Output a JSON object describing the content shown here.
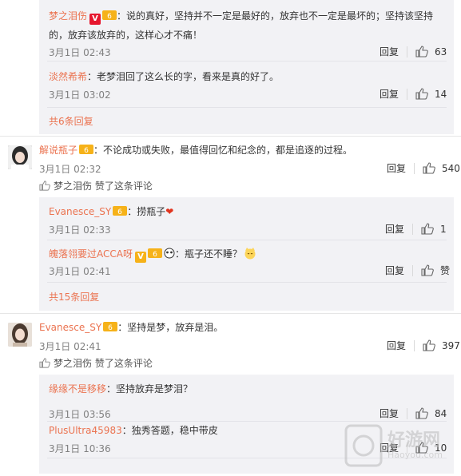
{
  "thread1": {
    "replies": [
      {
        "user": "梦之泪伤",
        "text_line1": "：说的真好，坚持并不一定是最好的，放弃也不一定是最坏的；坚持该坚持",
        "text_line2": "的，放弃该放弃的，这样心才不痛！",
        "time": "3月1日 02:43",
        "reply_label": "回复",
        "likes": "63"
      },
      {
        "user": "淡然希希",
        "text": "：老梦泪回了这么长的字，看来是真的好了。",
        "time": "3月1日 03:02",
        "reply_label": "回复",
        "likes": "14"
      }
    ],
    "more": "共6条回复"
  },
  "comment2": {
    "user": "解说瓶子",
    "text": "：不论成功或失败，最值得回忆和纪念的，都是追逐的过程。",
    "time": "3月1日 02:32",
    "reply_label": "回复",
    "likes": "540",
    "liked_by_user": "梦之泪伤",
    "liked_by_suffix": "赞了这条评论",
    "replies": [
      {
        "user": "Evanesce_SY",
        "text": "：捞瓶子",
        "time": "3月1日 02:33",
        "reply_label": "回复",
        "likes": "1"
      },
      {
        "user": "魄落翎要过ACCA呀",
        "text": "：瓶子还不睡？",
        "time": "3月1日 02:41",
        "reply_label": "回复",
        "likes": "赞"
      }
    ],
    "more": "共15条回复"
  },
  "comment3": {
    "user": "Evanesce_SY",
    "text": "：坚持是梦，放弃是泪。",
    "time": "3月1日 02:41",
    "reply_label": "回复",
    "likes": "397",
    "liked_by_user": "梦之泪伤",
    "liked_by_suffix": "赞了这条评论",
    "replies": [
      {
        "user": "缘缘不是移移",
        "text": "：坚持放弃是梦泪？",
        "time": "3月1日 03:56",
        "reply_label": "回复",
        "likes": "84"
      },
      {
        "user": "PlusUltra45983",
        "text": "：独秀答题，稳中带皮",
        "time": "3月1日 10:36",
        "reply_label": "回复",
        "likes": "10"
      }
    ]
  },
  "watermark": {
    "line1": "好游网",
    "line2": "Haoyou.com"
  },
  "colors": {
    "username": "#eb7350",
    "reply_bg": "#f2f2f5",
    "time": "#808080"
  }
}
